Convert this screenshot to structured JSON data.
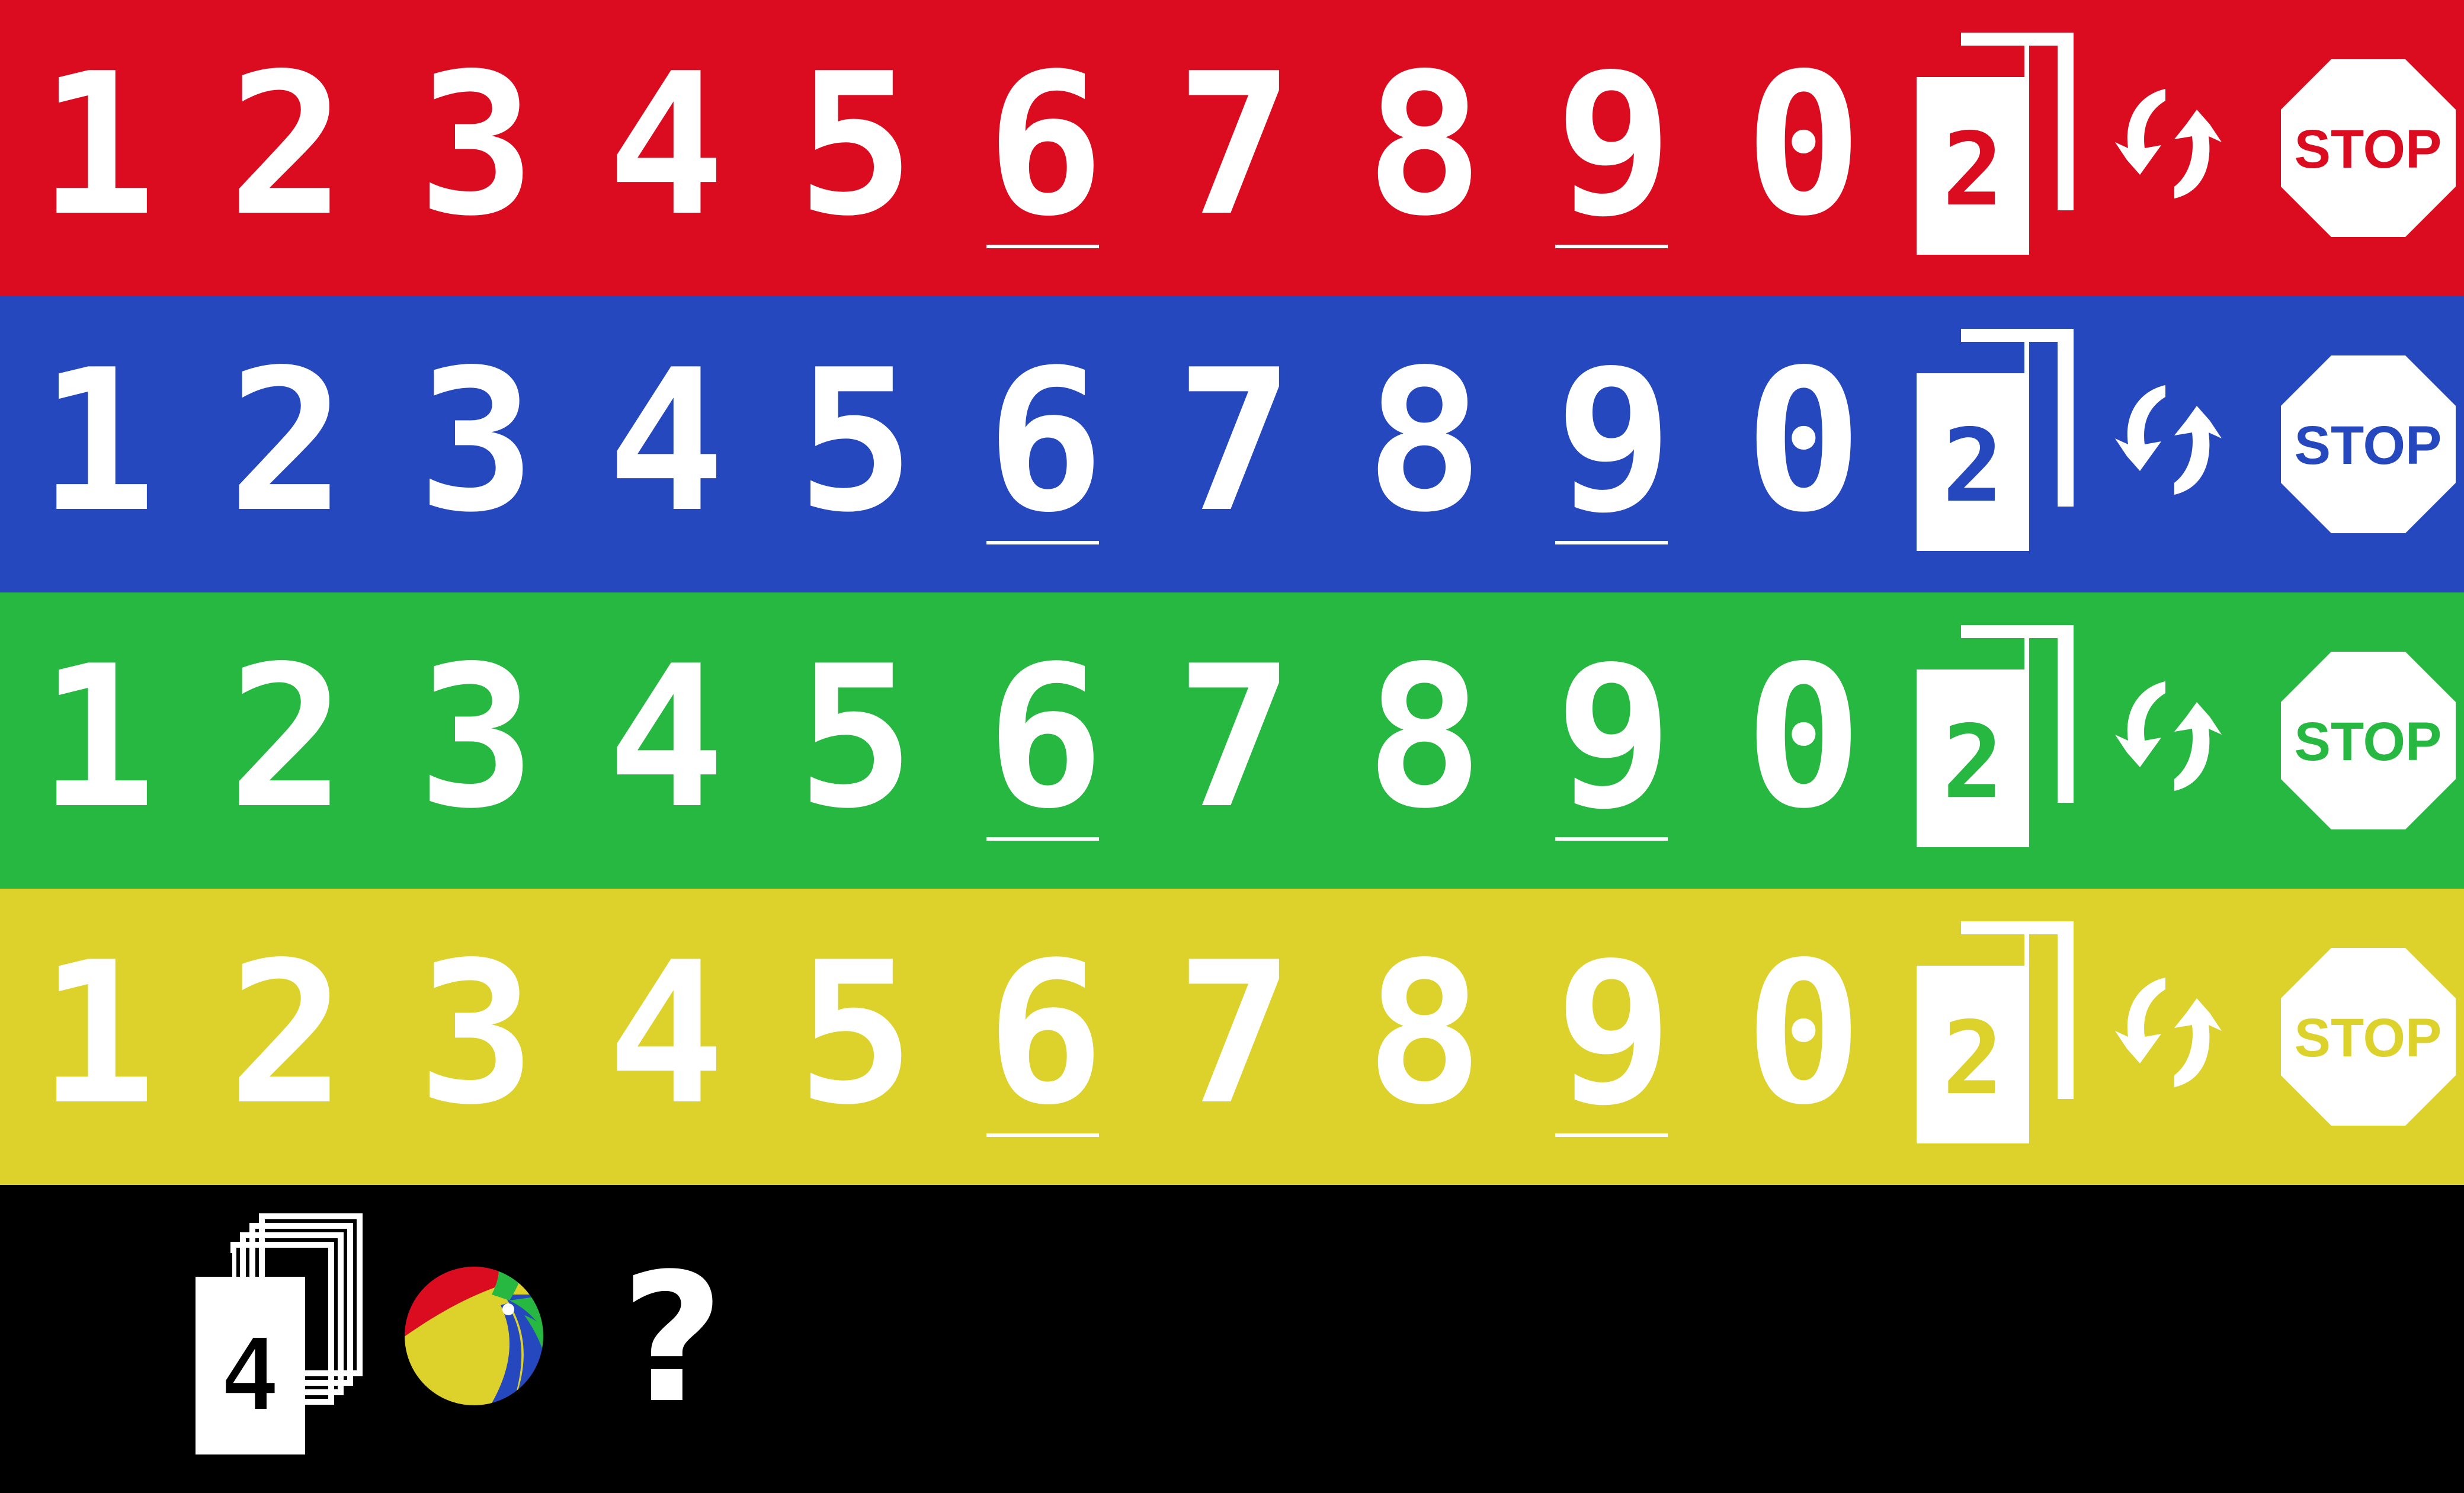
{
  "rows": [
    {
      "name": "red",
      "color": "#dc0c20"
    },
    {
      "name": "blue",
      "color": "#2648be"
    },
    {
      "name": "green",
      "color": "#26b840"
    },
    {
      "name": "yellow",
      "color": "#ddd22c"
    }
  ],
  "numbers": [
    "1",
    "2",
    "3",
    "4",
    "5",
    "6",
    "7",
    "8",
    "9",
    "0"
  ],
  "underlined_numbers": [
    "6",
    "9"
  ],
  "draw_two_card": {
    "icon": "draw-two-card-icon",
    "value": "2"
  },
  "reverse": {
    "icon": "reverse-arrows-icon"
  },
  "stop": {
    "icon": "stop-sign-icon",
    "text": "STOP"
  },
  "bottom": {
    "deck": {
      "icon": "card-deck-icon",
      "value": "4"
    },
    "ball": {
      "icon": "beach-ball-icon",
      "colors": [
        "#dc0c20",
        "#2648be",
        "#26b840",
        "#ddd22c"
      ]
    },
    "question": "?"
  }
}
